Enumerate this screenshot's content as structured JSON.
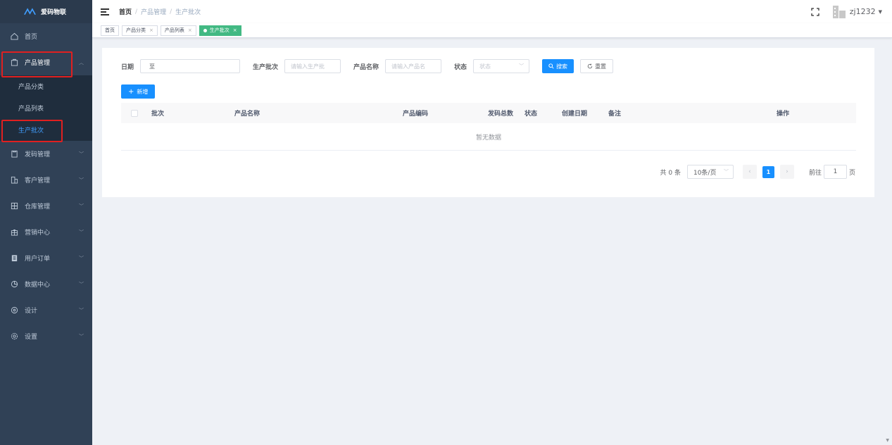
{
  "app": {
    "name": "爱码物联"
  },
  "sidebar": {
    "items": [
      {
        "label": "首页",
        "icon": "home-icon"
      },
      {
        "label": "产品管理",
        "icon": "product-icon",
        "expanded": true,
        "children": [
          {
            "label": "产品分类"
          },
          {
            "label": "产品列表"
          },
          {
            "label": "生产批次",
            "active": true
          }
        ]
      },
      {
        "label": "发码管理",
        "icon": "code-icon"
      },
      {
        "label": "客户管理",
        "icon": "customer-icon"
      },
      {
        "label": "仓库管理",
        "icon": "warehouse-icon"
      },
      {
        "label": "营销中心",
        "icon": "gift-icon"
      },
      {
        "label": "用户订单",
        "icon": "order-icon"
      },
      {
        "label": "数据中心",
        "icon": "chart-icon"
      },
      {
        "label": "设计",
        "icon": "design-icon"
      },
      {
        "label": "设置",
        "icon": "settings-icon"
      }
    ]
  },
  "header": {
    "breadcrumb": [
      "首页",
      "产品管理",
      "生产批次"
    ],
    "user": "zj1232"
  },
  "tags": [
    {
      "label": "首页",
      "closable": false
    },
    {
      "label": "产品分类",
      "closable": true
    },
    {
      "label": "产品列表",
      "closable": true
    },
    {
      "label": "生产批次",
      "closable": true,
      "active": true
    }
  ],
  "filters": {
    "date_label": "日期",
    "date_separator": "至",
    "batch_label": "生产批次",
    "batch_placeholder": "请输入生产批",
    "product_label": "产品名称",
    "product_placeholder": "请输入产品名",
    "status_label": "状态",
    "status_placeholder": "状态",
    "search_button": "搜索",
    "reset_button": "重置"
  },
  "add_button": "新增",
  "table": {
    "columns": [
      "批次",
      "产品名称",
      "产品编码",
      "发码总数",
      "状态",
      "创建日期",
      "备注",
      "操作"
    ],
    "empty_text": "暂无数据"
  },
  "pagination": {
    "total_text": "共 0 条",
    "page_size": "10条/页",
    "current_page": "1",
    "goto_label": "前往",
    "goto_value": "1",
    "page_suffix": "页"
  },
  "colors": {
    "sidebar_bg": "#304156",
    "primary": "#1890ff",
    "active_tag": "#42b983",
    "highlight": "#e02020"
  }
}
